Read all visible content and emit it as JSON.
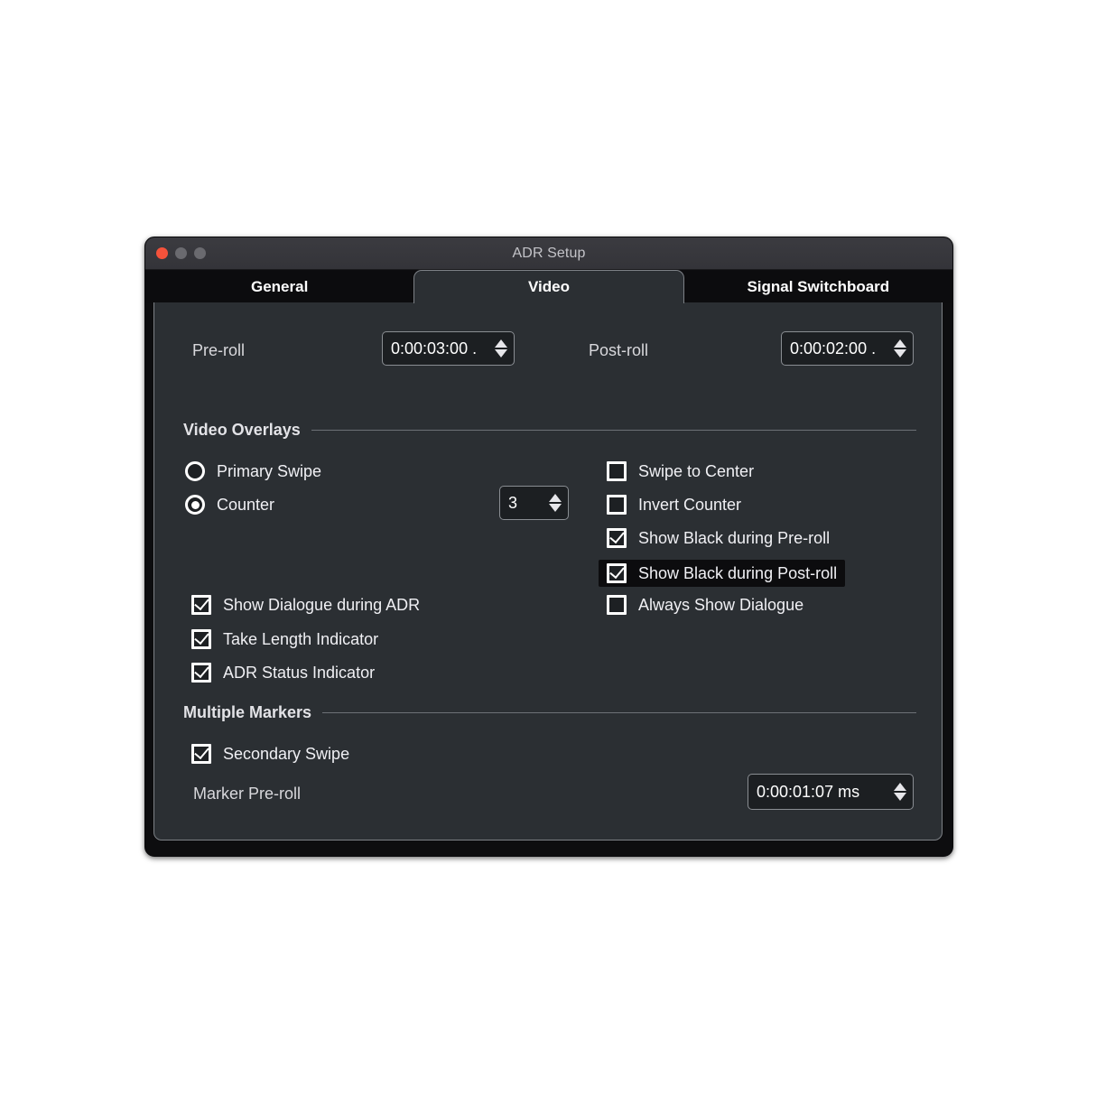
{
  "window": {
    "title": "ADR Setup",
    "traffic_lights": [
      "close",
      "minimize",
      "maximize"
    ]
  },
  "tabs": [
    {
      "label": "General",
      "active": false
    },
    {
      "label": "Video",
      "active": true
    },
    {
      "label": "Signal Switchboard",
      "active": false
    }
  ],
  "rolls": {
    "preroll_label": "Pre-roll",
    "preroll_value": "0:00:03:00 .",
    "postroll_label": "Post-roll",
    "postroll_value": "0:00:02:00 ."
  },
  "video_overlays": {
    "section_title": "Video Overlays",
    "radios": [
      {
        "label": "Primary Swipe",
        "selected": false
      },
      {
        "label": "Counter",
        "selected": true
      }
    ],
    "counter_value": "3",
    "left_checkboxes": [
      {
        "label": "Show Dialogue during ADR",
        "checked": true
      },
      {
        "label": "Take Length Indicator",
        "checked": true
      },
      {
        "label": "ADR Status Indicator",
        "checked": true
      }
    ],
    "right_checkboxes": [
      {
        "label": "Swipe to Center",
        "checked": false,
        "highlighted": false
      },
      {
        "label": "Invert Counter",
        "checked": false,
        "highlighted": false
      },
      {
        "label": "Show Black during Pre-roll",
        "checked": true,
        "highlighted": false
      },
      {
        "label": "Show Black during Post-roll",
        "checked": true,
        "highlighted": true
      },
      {
        "label": "Always Show Dialogue",
        "checked": false,
        "highlighted": false
      }
    ]
  },
  "multiple_markers": {
    "section_title": "Multiple Markers",
    "secondary_swipe_label": "Secondary Swipe",
    "secondary_swipe_checked": true,
    "marker_preroll_label": "Marker Pre-roll",
    "marker_preroll_value": "0:00:01:07 ms"
  },
  "colors": {
    "panel_bg": "#2b2f33",
    "titlebar_bg": "#37373c",
    "tabstrip_bg": "#0c0c0e",
    "accent_close": "#f4523b",
    "text": "#f0f0f4",
    "field_bg": "#1c1f22",
    "field_border": "#8a8e93",
    "highlight_bg": "#0c0c0e"
  }
}
